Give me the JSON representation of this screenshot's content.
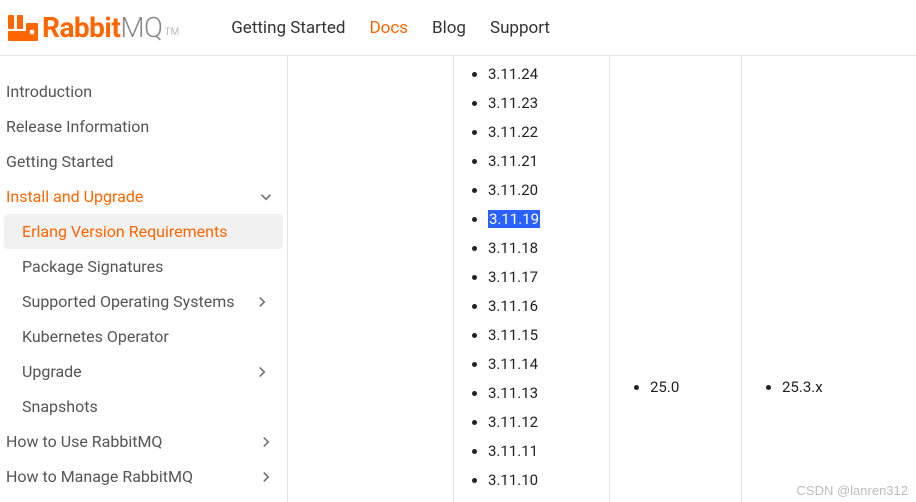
{
  "brand": {
    "name1": "Rabbit",
    "name2": "MQ",
    "tm": "TM"
  },
  "topnav": [
    {
      "label": "Getting Started",
      "active": false
    },
    {
      "label": "Docs",
      "active": true
    },
    {
      "label": "Blog",
      "active": false
    },
    {
      "label": "Support",
      "active": false
    }
  ],
  "sidebar": {
    "items": [
      {
        "label": "Introduction",
        "type": "item"
      },
      {
        "label": "Release Information",
        "type": "item"
      },
      {
        "label": "Getting Started",
        "type": "item"
      },
      {
        "label": "Install and Upgrade",
        "type": "section",
        "expanded": true
      },
      {
        "label": "Erlang Version Requirements",
        "type": "sub",
        "active": true
      },
      {
        "label": "Package Signatures",
        "type": "sub"
      },
      {
        "label": "Supported Operating Systems",
        "type": "sub",
        "chev": true
      },
      {
        "label": "Kubernetes Operator",
        "type": "sub"
      },
      {
        "label": "Upgrade",
        "type": "sub",
        "chev": true
      },
      {
        "label": "Snapshots",
        "type": "sub"
      },
      {
        "label": "How to Use RabbitMQ",
        "type": "item",
        "chev": true
      },
      {
        "label": "How to Manage RabbitMQ",
        "type": "item",
        "chev": true
      }
    ]
  },
  "versions": {
    "list": [
      "3.11.24",
      "3.11.23",
      "3.11.22",
      "3.11.21",
      "3.11.20",
      "3.11.19",
      "3.11.18",
      "3.11.17",
      "3.11.16",
      "3.11.15",
      "3.11.14",
      "3.11.13",
      "3.11.12",
      "3.11.11",
      "3.11.10"
    ],
    "selected": "3.11.19"
  },
  "erlang_min": "25.0",
  "erlang_max": "25.3.x",
  "watermark": "CSDN @lanren312"
}
